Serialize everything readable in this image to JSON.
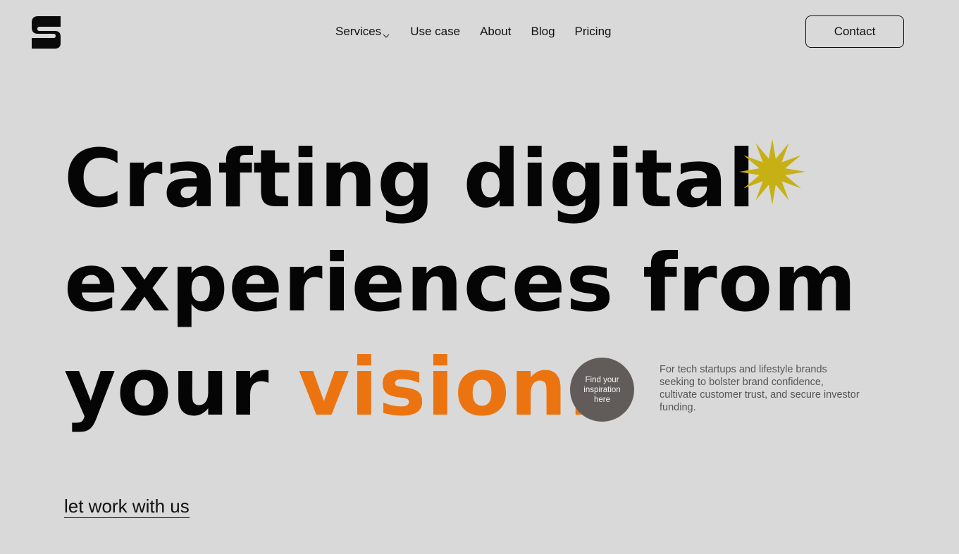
{
  "header": {
    "logo_icon": "brand-s-logo-icon",
    "nav": [
      {
        "label": "Services",
        "has_dropdown": true
      },
      {
        "label": "Use case"
      },
      {
        "label": "About"
      },
      {
        "label": "Blog"
      },
      {
        "label": "Pricing"
      }
    ],
    "contact_label": "Contact"
  },
  "hero": {
    "line1": "Crafting digital",
    "line2": "experiences from",
    "line3_plain": "your ",
    "line3_accent": "vision.",
    "star_icon": "sparkle-star-icon"
  },
  "badge": {
    "text": "Find your inspiration here"
  },
  "tagline": "For tech startups and lifestyle brands seeking to bolster brand  confidence, cultivate customer trust, and secure investor funding.",
  "cta": {
    "label": "let work with us"
  },
  "colors": {
    "background": "#d9d9d9",
    "accent_orange": "#ec7410",
    "star_yellow": "#c7b014",
    "badge_gray": "#615c59",
    "text_dark": "#050505"
  }
}
